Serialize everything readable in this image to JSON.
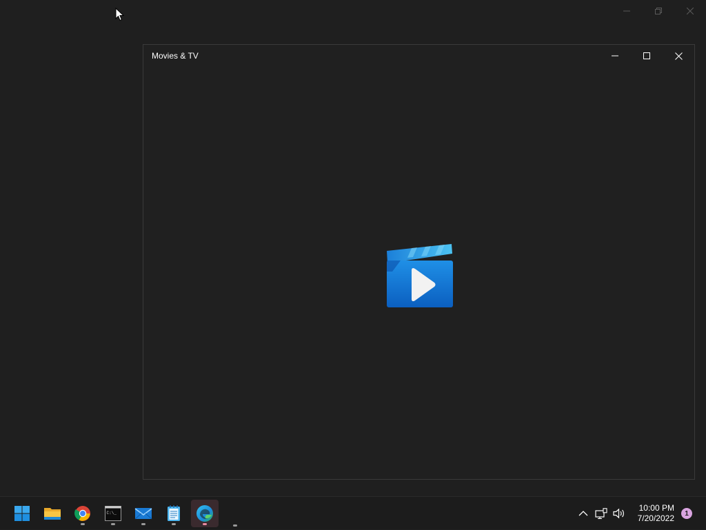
{
  "window": {
    "title": "Movies & TV"
  },
  "tray": {
    "time": "10:00 PM",
    "date": "7/20/2022",
    "notification_count": "1"
  },
  "taskbar": {
    "apps": [
      {
        "icon": "windows-start-icon",
        "running": false
      },
      {
        "icon": "file-explorer-icon",
        "running": false
      },
      {
        "icon": "chrome-icon",
        "running": true
      },
      {
        "icon": "terminal-icon",
        "running": true
      },
      {
        "icon": "mail-icon",
        "running": true
      },
      {
        "icon": "notepad-icon",
        "running": true
      },
      {
        "icon": "edge-icon",
        "running": true,
        "active": true
      }
    ]
  },
  "colors": {
    "desktop_bg": "#1f1f1f",
    "window_bg": "#202020",
    "taskbar_bg": "#1c1c1c",
    "accent_blue": "#0f78d4",
    "badge": "#d9a4e0"
  }
}
